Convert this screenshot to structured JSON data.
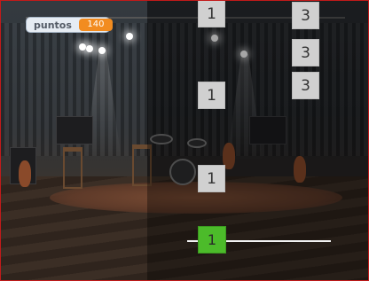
{
  "score": {
    "label": "puntos",
    "value": "140"
  },
  "notes": [
    {
      "lane": "left",
      "value": "1"
    },
    {
      "lane": "right",
      "value": "3"
    },
    {
      "lane": "right",
      "value": "3"
    },
    {
      "lane": "right",
      "value": "3"
    },
    {
      "lane": "left",
      "value": "1"
    },
    {
      "lane": "left",
      "value": "1"
    }
  ],
  "player": {
    "value": "1"
  },
  "colors": {
    "border": "#c21a1a",
    "score_badge": "#f28c20",
    "player": "#4cbb2a",
    "tile": "#d0d0d0"
  }
}
